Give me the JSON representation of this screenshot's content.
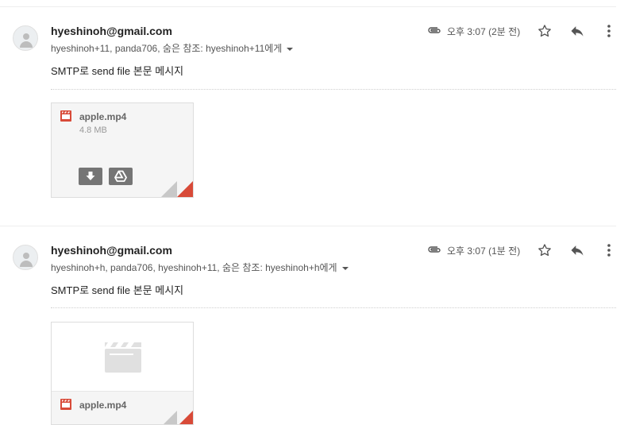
{
  "messages": [
    {
      "sender": "hyeshinoh@gmail.com",
      "recipients": "hyeshinoh+11, panda706, 숨은 참조: hyeshinoh+11에게",
      "time": "오후 3:07 (2분 전)",
      "snippet": "SMTP로 send file 본문 메시지",
      "attachment": {
        "name": "apple.mp4",
        "size": "4.8 MB",
        "style": "card-with-actions"
      }
    },
    {
      "sender": "hyeshinoh@gmail.com",
      "recipients": "hyeshinoh+h, panda706, hyeshinoh+11, 숨은 참조: hyeshinoh+h에게",
      "time": "오후 3:07 (1분 전)",
      "snippet": "SMTP로 send file 본문 메시지",
      "attachment": {
        "name": "apple.mp4",
        "style": "video-preview"
      }
    }
  ],
  "icons": {
    "avatar": "person-icon",
    "attachment": "paperclip-icon",
    "star": "star-icon",
    "reply": "reply-icon",
    "more": "more-vert-icon",
    "file": "video-file-icon",
    "download": "download-icon",
    "drive": "google-drive-icon"
  },
  "colors": {
    "video_icon": "#d84a38",
    "fold": "#d84a38",
    "text_primary": "#222222",
    "text_secondary": "#555555"
  }
}
